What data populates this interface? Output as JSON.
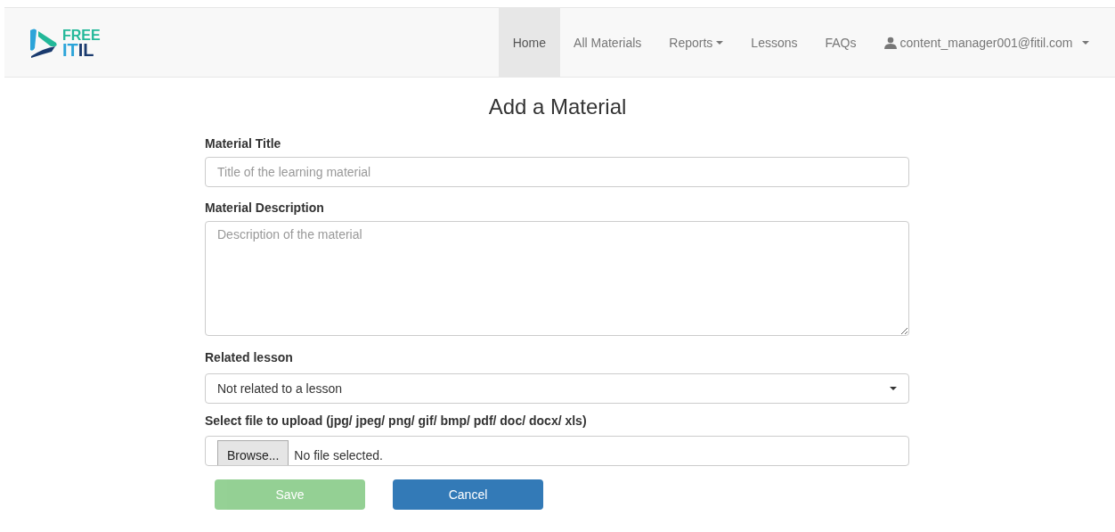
{
  "logo": {
    "line_1": "FREE",
    "line_2_a": "IT",
    "line_2_b": "IL"
  },
  "nav": [
    {
      "label": "Home",
      "selected": true,
      "kind": "link"
    },
    {
      "label": "All Materials",
      "selected": false,
      "kind": "link"
    },
    {
      "label": "Reports",
      "selected": false,
      "kind": "dropdown"
    },
    {
      "label": "Lessons",
      "selected": false,
      "kind": "link"
    },
    {
      "label": "FAQs",
      "selected": false,
      "kind": "link"
    },
    {
      "label": "content_manager001@fitil.com",
      "selected": false,
      "kind": "user"
    }
  ],
  "heading": "Add a Material",
  "form": {
    "title_label": "Material Title",
    "title_placeholder": "Title of the learning material",
    "description_label": "Material Description",
    "description_placeholder": "Description of the material",
    "lesson_label": "Related lesson",
    "lesson_value": "Not related to a lesson",
    "file_label": "Select file to upload (jpg/ jpeg/ png/ gif/ bmp/ pdf/ doc/ docx/ xls)",
    "browse": "Browse...",
    "file_status": "No file selected."
  },
  "buttons": [
    {
      "label": "Save",
      "kind": "save",
      "disabled": true
    },
    {
      "label": "Cancel",
      "kind": "cancel",
      "disabled": false
    }
  ]
}
